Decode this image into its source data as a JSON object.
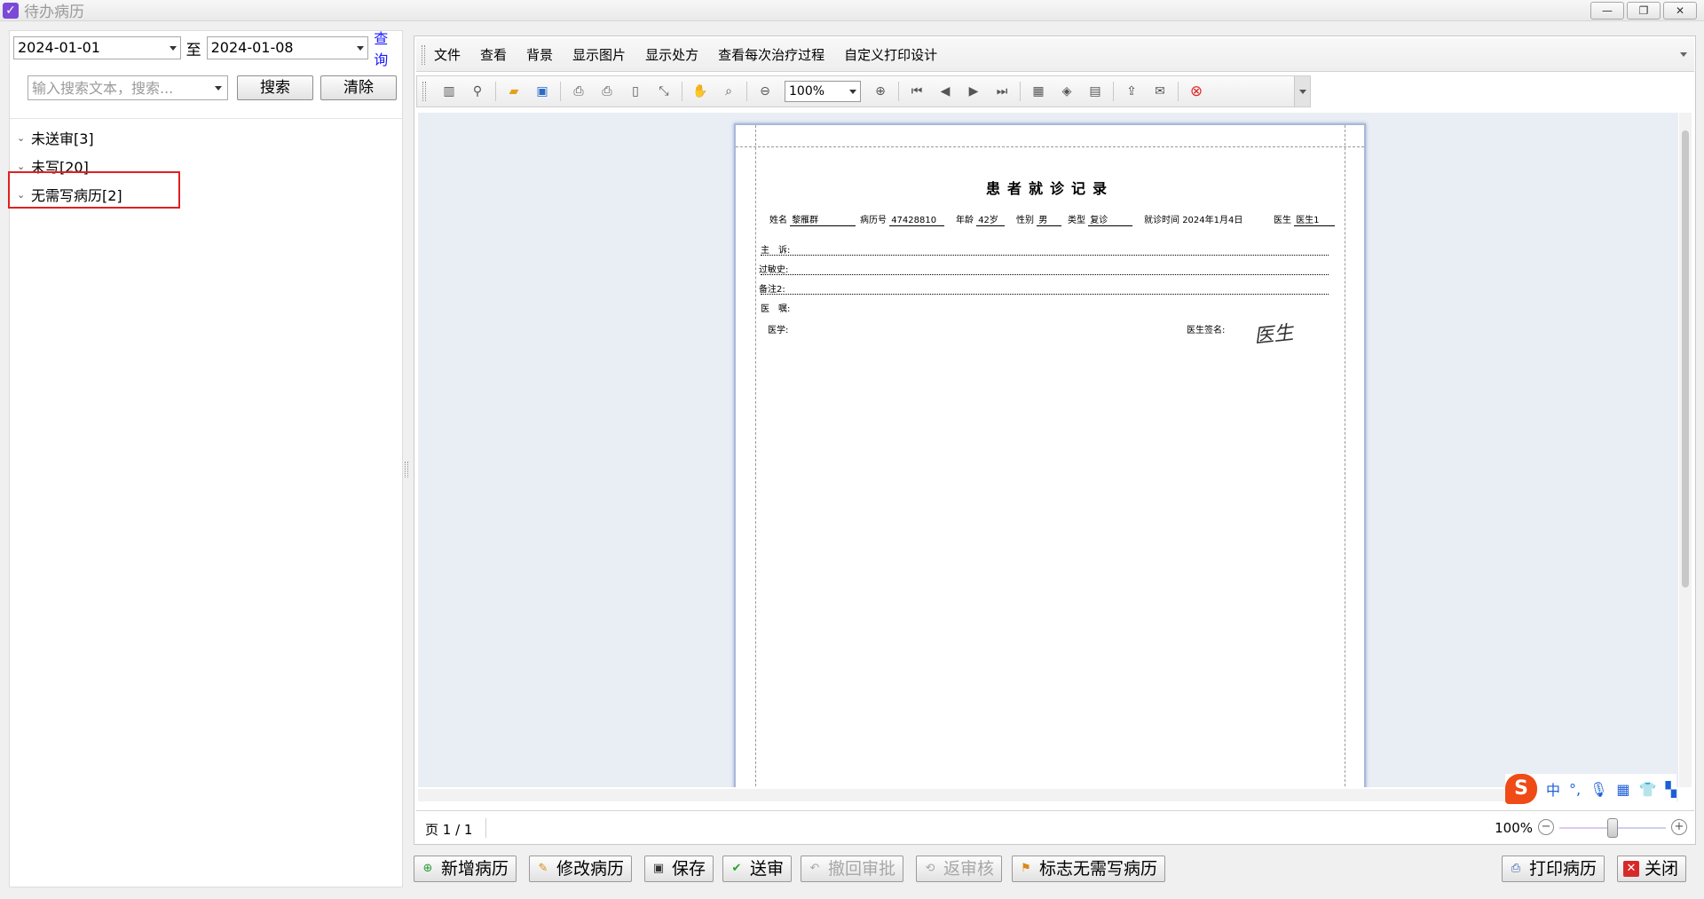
{
  "window": {
    "title": "待办病历",
    "buttons": [
      "—",
      "❐",
      "✕"
    ]
  },
  "left": {
    "date_from": "2024-01-01",
    "to_label": "至",
    "date_to": "2024-01-08",
    "query_link": "查询",
    "search_placeholder": "输入搜索文本，搜索...",
    "search_button": "搜索",
    "clear_button": "清除",
    "tree": [
      {
        "label": "未送审[3]"
      },
      {
        "label": "未写[20]"
      },
      {
        "label": "无需写病历[2]"
      }
    ]
  },
  "menubar": {
    "items": [
      "文件",
      "查看",
      "背景",
      "显示图片",
      "显示处方",
      "查看每次治疗过程",
      "自定义打印设计"
    ]
  },
  "toolbar": {
    "zoom_value": "100%"
  },
  "document": {
    "title": "患者就诊记录",
    "fields": {
      "name_label": "姓名",
      "name_value": "黎雁群",
      "record_label": "病历号",
      "record_value": "47428810",
      "age_label": "年龄",
      "age_value": "42岁",
      "sex_label": "性别",
      "sex_value": "男",
      "type_label": "类型",
      "type_value": "复诊",
      "visit_label": "就诊时间",
      "visit_value": "2024年1月4日",
      "doctor_label": "医生",
      "doctor_value": "医生1"
    },
    "lines": {
      "complaint": "主　诉:",
      "allergy": "过敏史:",
      "note2": "备注2:",
      "diagnosis": "医　嘱:",
      "advice": "医学:",
      "signature_label": "医生签名:"
    },
    "signature": "医生"
  },
  "status": {
    "page_info": "页 1 / 1",
    "zoom_percent": "100%",
    "zoom_level_fraction": 0.5
  },
  "ime": {
    "logo": "S",
    "mode": "中"
  },
  "bottom_buttons": {
    "add": "新增病历",
    "edit": "修改病历",
    "save": "保存",
    "send": "送审",
    "revoke": "撤回审批",
    "return": "返审核",
    "mark": "标志无需写病历",
    "print": "打印病历",
    "close": "关闭"
  }
}
